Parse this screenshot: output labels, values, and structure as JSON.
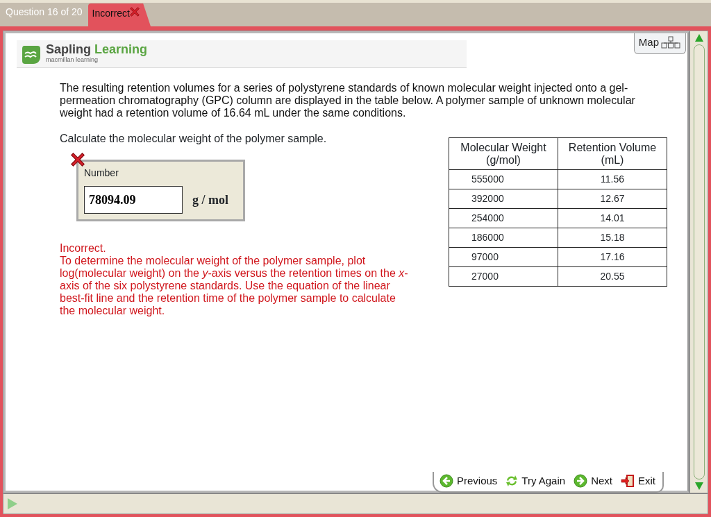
{
  "header": {
    "question_label": "Question 16 of 20",
    "status_tab": {
      "label": "Incorrect",
      "kind": "incorrect"
    }
  },
  "logo": {
    "name": "Sapling",
    "name_accent": "Learning",
    "tagline": "macmillan learning"
  },
  "map_button": {
    "label": "Map"
  },
  "question": {
    "text": "The resulting retention volumes for a series of polystyrene standards of known molecular weight injected onto a gel-permeation chromatography (GPC) column are displayed in the table below. A polymer sample of unknown molecular weight had a retention volume of 16.64 mL under the same conditions.",
    "prompt": "Calculate the molecular weight of the polymer sample."
  },
  "answer": {
    "label": "Number",
    "value": "78094.09",
    "unit": "g / mol",
    "correct": false
  },
  "feedback": {
    "title": "Incorrect.",
    "body": "To determine the molecular weight of the polymer sample, plot log(molecular weight) on the *y*-axis versus the retention times on the *x*-axis of the six polystyrene standards. Use the equation of the linear best-fit line and the retention time of the polymer sample to calculate the molecular weight."
  },
  "table": {
    "columns": [
      "Molecular Weight (g/mol)",
      "Retention Volume (mL)"
    ],
    "rows": [
      [
        "555000",
        "11.56"
      ],
      [
        "392000",
        "12.67"
      ],
      [
        "254000",
        "14.01"
      ],
      [
        "186000",
        "15.18"
      ],
      [
        "97000",
        "17.16"
      ],
      [
        "27000",
        "20.55"
      ]
    ]
  },
  "nav_buttons": [
    {
      "label": "Previous",
      "kind": "previous"
    },
    {
      "label": "Try Again",
      "kind": "retry"
    },
    {
      "label": "Next",
      "kind": "next"
    },
    {
      "label": "Exit",
      "kind": "exit"
    }
  ]
}
